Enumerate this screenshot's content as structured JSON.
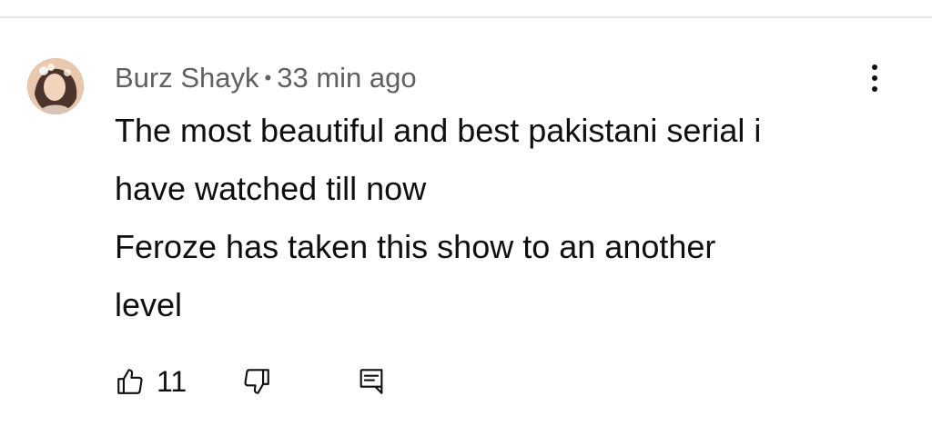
{
  "comment": {
    "author": "Burz Shayk",
    "separator": "•",
    "timestamp": "33 min ago",
    "lines": [
      "The most beautiful and best pakistani serial i",
      "have watched till now",
      "Feroze has taken this show to an another",
      "level"
    ],
    "likes": "11"
  },
  "icons": {
    "like": "thumbs-up-icon",
    "dislike": "thumbs-down-icon",
    "reply": "reply-comment-icon",
    "more": "more-vertical-icon"
  },
  "colors": {
    "text": "#0f0f0f",
    "meta": "#606060",
    "divider": "#e5e5e5"
  }
}
